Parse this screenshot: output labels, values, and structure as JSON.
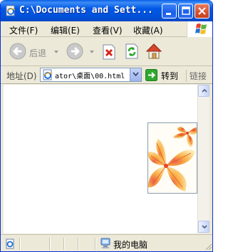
{
  "window": {
    "title": "C:\\Documents and Sett..."
  },
  "menu": [
    {
      "label": "文件(F)"
    },
    {
      "label": "编辑(E)"
    },
    {
      "label": "查看(V)"
    },
    {
      "label": "收藏(A)"
    }
  ],
  "toolbar": {
    "back_label": "后退",
    "icons": [
      "back-arrow",
      "forward-arrow",
      "stop",
      "refresh",
      "home"
    ]
  },
  "address": {
    "label": "地址(D)",
    "value": "ator\\桌面\\00.html",
    "go_label": "转到",
    "links_label": "链接"
  },
  "content": {
    "image": "flower-illustration"
  },
  "status": {
    "zone_label": "我的电脑"
  },
  "colors": {
    "titlebar": "#0058e6",
    "chrome": "#ece9d8",
    "close_button": "#d6512f",
    "go_arrow": "#2ea82e"
  }
}
